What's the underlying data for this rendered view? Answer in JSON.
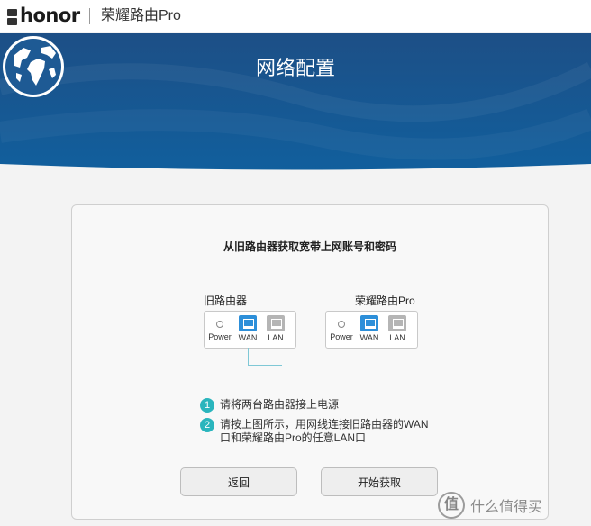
{
  "header": {
    "brand": "honor",
    "brand_seal": "荣耀",
    "product_title": "荣耀路由Pro"
  },
  "banner": {
    "title": "网络配置",
    "icon": "globe-icon",
    "color_top": "#1d4f86",
    "color_bottom": "#115f9d"
  },
  "card": {
    "heading": "从旧路由器获取宽带上网账号和密码",
    "old_router": {
      "label": "旧路由器",
      "ports": {
        "power": "Power",
        "wan": "WAN",
        "lan": "LAN"
      }
    },
    "new_router": {
      "label": "荣耀路由Pro",
      "ports": {
        "power": "Power",
        "wan": "WAN",
        "lan": "LAN"
      }
    },
    "steps": [
      {
        "num": "1",
        "text": "请将两台路由器接上电源"
      },
      {
        "num": "2",
        "text_line1": "请按上图所示，用网线连接旧路由器的WAN",
        "text_line2": "口和荣耀路由Pro的任意LAN口"
      }
    ],
    "buttons": {
      "back": "返回",
      "start": "开始获取"
    }
  },
  "colors": {
    "wan_port": "#2d8fd9",
    "lan_port": "#b5b5b5",
    "step_badge": "#2ab5bd",
    "cable": "#7fc8d6"
  },
  "watermark": {
    "badge": "值",
    "text": "什么值得买"
  }
}
